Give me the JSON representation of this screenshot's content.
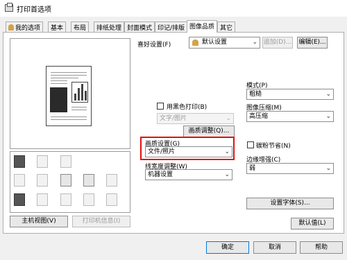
{
  "window": {
    "title": "打印首选项"
  },
  "tabs": [
    "我的选项",
    "基本",
    "布局",
    "排纸处理",
    "封面模式",
    "印记/排版",
    "图像品质",
    "其它"
  ],
  "active_tab": "图像品质",
  "favorite": {
    "label": "喜好设置(F)",
    "value": "默认设置",
    "add_label": "追加(D)...",
    "edit_label": "编辑(E)..."
  },
  "left": {
    "printer_view_label": "主机视图(V)",
    "printer_info_label": "打印机信息(I)"
  },
  "grayscale": {
    "label": "用黑色打印(B)",
    "value": "文字/图片"
  },
  "quality_adjust_label": "画质调整(Q)...",
  "image_setting": {
    "label": "画质设置(G)",
    "value": "文件/照片"
  },
  "line_width": {
    "label": "线宽度调整(W)",
    "value": "机器设置"
  },
  "mode": {
    "label": "模式(P)",
    "value": "粗糙"
  },
  "compression": {
    "label": "图像压缩(M)",
    "value": "高压缩"
  },
  "toner_save_label": "碳粉节省(N)",
  "edge": {
    "label": "边缘增强(C)",
    "value": "弱"
  },
  "font_setting_label": "设置字体(S)...",
  "default_label": "默认值(L)",
  "footer": {
    "ok": "确定",
    "cancel": "取消",
    "help": "帮助"
  }
}
